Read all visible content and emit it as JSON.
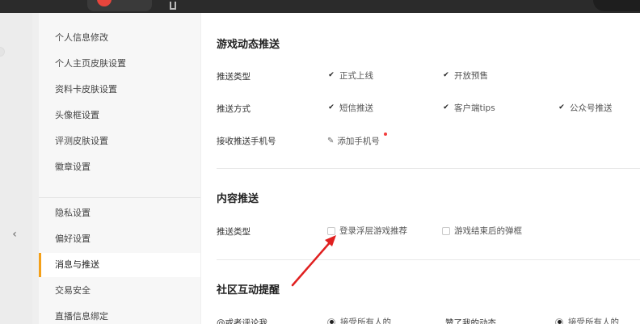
{
  "sidebar": {
    "items": [
      {
        "label": "个人信息修改",
        "active": false
      },
      {
        "label": "个人主页皮肤设置",
        "active": false
      },
      {
        "label": "资料卡皮肤设置",
        "active": false
      },
      {
        "label": "头像框设置",
        "active": false
      },
      {
        "label": "评测皮肤设置",
        "active": false
      },
      {
        "label": "徽章设置",
        "active": false
      },
      {
        "label": "隐私设置",
        "active": false
      },
      {
        "label": "偏好设置",
        "active": false
      },
      {
        "label": "消息与推送",
        "active": true
      },
      {
        "label": "交易安全",
        "active": false
      },
      {
        "label": "直播信息绑定",
        "active": false
      }
    ],
    "collapse_glyph": "‹"
  },
  "sections": {
    "game": {
      "title": "游戏动态推送",
      "type_label": "推送类型",
      "type_options": [
        {
          "label": "正式上线",
          "checked": true
        },
        {
          "label": "开放预售",
          "checked": true
        }
      ],
      "method_label": "推送方式",
      "method_options": [
        {
          "label": "短信推送",
          "checked": true
        },
        {
          "label": "客户端tips",
          "checked": true
        },
        {
          "label": "公众号推送",
          "checked": true
        }
      ],
      "phone_label": "接收推送手机号",
      "add_phone": "添加手机号"
    },
    "content": {
      "title": "内容推送",
      "type_label": "推送类型",
      "options": [
        {
          "label": "登录浮层游戏推荐",
          "checked": false
        },
        {
          "label": "游戏结束后的弹框",
          "checked": false
        }
      ]
    },
    "community": {
      "title": "社区互动提醒",
      "row1_label": "@或者评论我",
      "row1_value": "接受所有人的",
      "row2_label": "赞了我的动态",
      "row2_value": "接受所有人的"
    }
  },
  "glyphs": {
    "check": "✔",
    "pencil": "✎"
  },
  "colors": {
    "accent": "#f4a019",
    "arrow": "#e02020",
    "badge": "#f23c3c"
  }
}
